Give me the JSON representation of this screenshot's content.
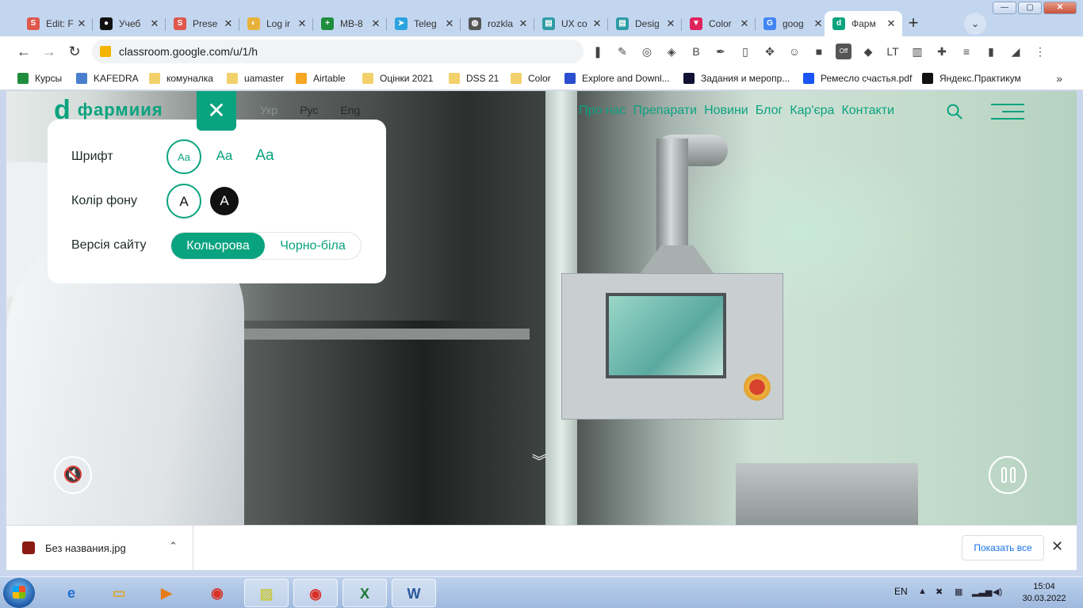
{
  "window": {
    "minimize": "—",
    "maximize": "▢",
    "close": "✕"
  },
  "tabs": [
    {
      "title": "Edit: F",
      "icon": "slides-s-icon",
      "color": "#e0584c",
      "glyph": "S"
    },
    {
      "title": "Учеб",
      "icon": "video-icon",
      "color": "#111111",
      "glyph": "●"
    },
    {
      "title": "Prese",
      "icon": "slides-s-icon",
      "color": "#e0584c",
      "glyph": "S"
    },
    {
      "title": "Log ir",
      "icon": "circle-logo-icon",
      "color": "#e8b23a",
      "glyph": "◐"
    },
    {
      "title": "MB-8",
      "icon": "plus-sheet-icon",
      "color": "#1e8e3e",
      "glyph": "+"
    },
    {
      "title": "Teleg",
      "icon": "telegram-icon",
      "color": "#2aa3df",
      "glyph": "➤"
    },
    {
      "title": "rozkla",
      "icon": "globe-icon",
      "color": "#555555",
      "glyph": "◍"
    },
    {
      "title": "UX co",
      "icon": "book-icon",
      "color": "#2f9ca5",
      "glyph": "▤"
    },
    {
      "title": "Desig",
      "icon": "book-icon",
      "color": "#2f9ca5",
      "glyph": "▤"
    },
    {
      "title": "Color",
      "icon": "color-hunt-icon",
      "color": "#e0245e",
      "glyph": "▼"
    },
    {
      "title": "goog",
      "icon": "google-icon",
      "color": "#4285f4",
      "glyph": "G"
    },
    {
      "title": "Фарм",
      "icon": "farmak-icon",
      "color": "#0aa37f",
      "glyph": "d"
    }
  ],
  "newtab": "+",
  "tabsearch": "⌄",
  "toolbar": {
    "back": "←",
    "forward": "→",
    "reload": "↻",
    "url": "classroom.google.com/u/1/h",
    "extensions": [
      "❚",
      "✎",
      "◎",
      "◈",
      "B",
      "✒",
      "▯",
      "✥",
      "☺",
      "■",
      "Off",
      "◆",
      "LT",
      "▥",
      "✚",
      "≡",
      "▮",
      "◢",
      "⋮"
    ]
  },
  "bookmarks": [
    {
      "label": "Курсы",
      "color": "#1e8e3e"
    },
    {
      "label": "KAFEDRA",
      "color": "#4a7fd0"
    },
    {
      "label": "комуналка",
      "color": "#f2d16b"
    },
    {
      "label": "uamaster",
      "color": "#f2d16b"
    },
    {
      "label": "Airtable",
      "color": "#f5a623"
    },
    {
      "label": "Оцінки 2021",
      "color": "#f2d16b"
    },
    {
      "label": "DSS 21",
      "color": "#f2d16b"
    },
    {
      "label": "Color",
      "color": "#f2d16b"
    },
    {
      "label": "Explore and Downl...",
      "color": "#2b4ed0"
    },
    {
      "label": "Задания и меропр...",
      "color": "#111133"
    },
    {
      "label": "Ремесло счастья.pdf",
      "color": "#1a55f5"
    },
    {
      "label": "Яндекс.Практикум",
      "color": "#111111"
    }
  ],
  "bookmarks_more": "»",
  "site": {
    "logo_text": "фармиия",
    "logo_glyph": "d",
    "langs": [
      "Укр",
      "Рус",
      "Eng"
    ],
    "nav": [
      "Про нас",
      "Препарати",
      "Новини",
      "Блог",
      "Кар'єра",
      "Контакти"
    ],
    "accent": "#0aa37f"
  },
  "a11y": {
    "close": "✕",
    "font_label": "Шрифт",
    "font_options": [
      "Aa",
      "Aa",
      "Aa"
    ],
    "bg_label": "Колір фону",
    "bg_options": [
      "A",
      "A"
    ],
    "version_label": "Версія сайту",
    "version_options": [
      "Кольорова",
      "Чорно-біла"
    ],
    "version_selected": "Кольорова"
  },
  "video": {
    "mute": "🔇",
    "scroll": "︾"
  },
  "download": {
    "file": "Без названия.jpg",
    "chevron": "⌃",
    "show_all": "Показать все",
    "close": "✕"
  },
  "taskbar": {
    "apps": [
      {
        "name": "ie",
        "glyph": "e",
        "color": "#1f6fd1"
      },
      {
        "name": "explorer",
        "glyph": "▭",
        "color": "#d9a935"
      },
      {
        "name": "media-player",
        "glyph": "▶",
        "color": "#e47c1a"
      },
      {
        "name": "chrome",
        "glyph": "◉",
        "color": "#d93025"
      },
      {
        "name": "sticky-notes",
        "glyph": "▨",
        "color": "#c7c94a"
      },
      {
        "name": "chrome-active",
        "glyph": "◉",
        "color": "#d93025"
      },
      {
        "name": "excel",
        "glyph": "X",
        "color": "#1d7a3a"
      },
      {
        "name": "word",
        "glyph": "W",
        "color": "#2b579a"
      }
    ],
    "lang": "EN",
    "tray": [
      "▲",
      "✖",
      "▦",
      "▂▃▅",
      "◀)"
    ],
    "time": "15:04",
    "date": "30.03.2022"
  }
}
